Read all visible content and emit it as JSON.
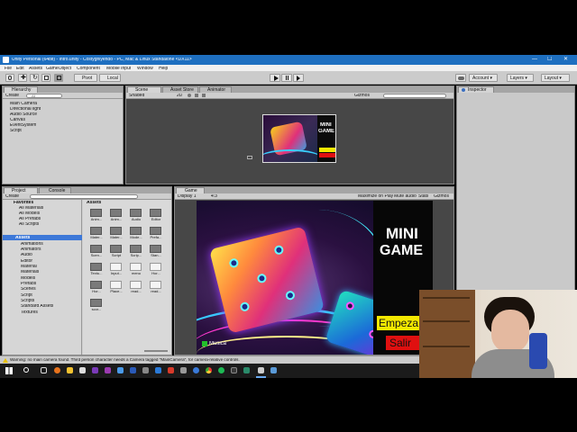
{
  "window": {
    "title": "Unity Personal (64bit) - Intro.unity - Costygniyendo - PC, Mac & Linux Standalone <DX11>",
    "min": "—",
    "max": "☐",
    "close": "✕"
  },
  "menu": [
    "File",
    "Edit",
    "Assets",
    "GameObject",
    "Component",
    "Mobile Input",
    "Window",
    "Help"
  ],
  "toolbar": {
    "pivot": "Pivot",
    "local": "Local",
    "account": "Account",
    "layers": "Layers",
    "layout": "Layout"
  },
  "hierarchy": {
    "tab": "Hierarchy",
    "create": "Create",
    "search_placeholder": "All",
    "items": [
      "Main Camera",
      "Directional light",
      "Audio Source",
      "Canvas",
      "EventSystem",
      "Script"
    ]
  },
  "scene": {
    "tabs": [
      "Scene",
      "Asset Store",
      "Animator"
    ],
    "shaded": "Shaded",
    "mode_2d": "2D",
    "gizmos": "Gizmos"
  },
  "inspector": {
    "tab": "Inspector"
  },
  "project": {
    "tabs": [
      "Project",
      "Console"
    ],
    "create": "Create",
    "favorites_header": "Favorites",
    "favorites": [
      "All Materials",
      "All Models",
      "All Prefabs",
      "All Scripts"
    ],
    "assets_header": "Assets",
    "folders": [
      "Animations",
      "Animators",
      "Audio",
      "Editor",
      "Material",
      "Materials",
      "Models",
      "Prefabs",
      "Scenes",
      "Script",
      "Scripts",
      "Standard Assets",
      "Textures"
    ],
    "assets_breadcrumb": "Assets",
    "grid": [
      [
        "Anim...",
        "Anim...",
        "Audio",
        "Editor"
      ],
      [
        "Mater...",
        "Mater...",
        "Mode...",
        "Prefa..."
      ],
      [
        "Scen...",
        "Script",
        "Scrip...",
        "Stan..."
      ],
      [
        "Textu...",
        "Input...",
        "menu",
        "Hor..."
      ],
      [
        "Hor...",
        "Place...",
        "read...",
        "read..."
      ],
      [
        "scor..."
      ]
    ]
  },
  "game": {
    "tab": "Game",
    "display": "Display 1",
    "aspect": "4:3",
    "maximize": "Maximize on Play",
    "mute": "Mute audio",
    "stats": "Stats",
    "gizmos": "Gizmos",
    "title_line1": "MINI",
    "title_line2": "GAME",
    "start_button": "Empeza",
    "exit_button": "Salir",
    "music_label": "Musica"
  },
  "scene_preview": {
    "title_line1": "MINI",
    "title_line2": "GAME"
  },
  "status": {
    "message": "Warning: no main camera found. Third person character needs a Camera tagged \"MainCamera\", for camera-relative controls."
  },
  "colors": {
    "title_blue": "#1e6fc0",
    "button_yellow": "#f3e800",
    "button_red": "#e01010",
    "music_green": "#22c02a"
  }
}
